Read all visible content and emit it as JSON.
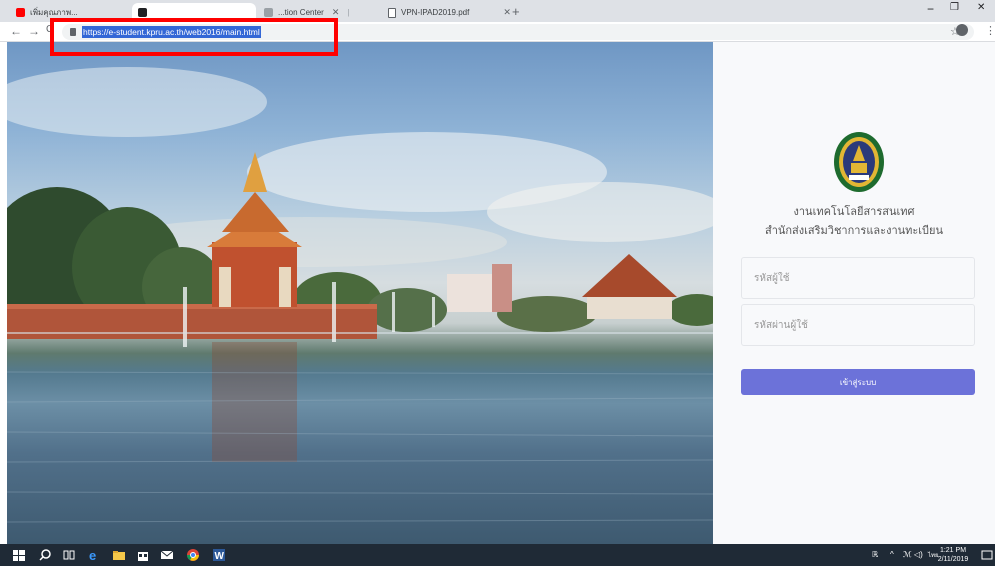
{
  "browser": {
    "tabs": [
      {
        "label": "เพิ่มคุณภาพ...",
        "active": false,
        "icon": "youtube-icon"
      },
      {
        "label": "",
        "active": true,
        "icon": "page-icon"
      },
      {
        "label": "...tion Center",
        "active": false,
        "icon": "page-icon"
      },
      {
        "label": "VPN-IPAD2019.pdf",
        "active": false,
        "icon": "document-icon"
      }
    ],
    "new_tab": "+",
    "controls": {
      "minimize": "−",
      "restore": "❐",
      "close": "✕"
    },
    "nav": {
      "back": "←",
      "forward": "→"
    },
    "url": "https://e-student.kpru.ac.th/web2016/main.html",
    "star": "☆",
    "menu": "⋮"
  },
  "login": {
    "org_line1": "งานเทคโนโลยีสารสนเทศ",
    "org_line2": "สำนักส่งเสริมวิชาการและงานทะเบียน",
    "username_placeholder": "รหัสผู้ใช้",
    "password_placeholder": "รหัสผ่านผู้ใช้",
    "login_button": "เข้าสู่ระบบ"
  },
  "taskbar": {
    "language": "ไทย",
    "time": "1:21 PM",
    "date": "2/11/2019"
  },
  "colors": {
    "accent_button": "#6c72d9",
    "highlight_box": "#ff0000",
    "url_selection": "#3367d6",
    "taskbar": "#1f2a36"
  }
}
